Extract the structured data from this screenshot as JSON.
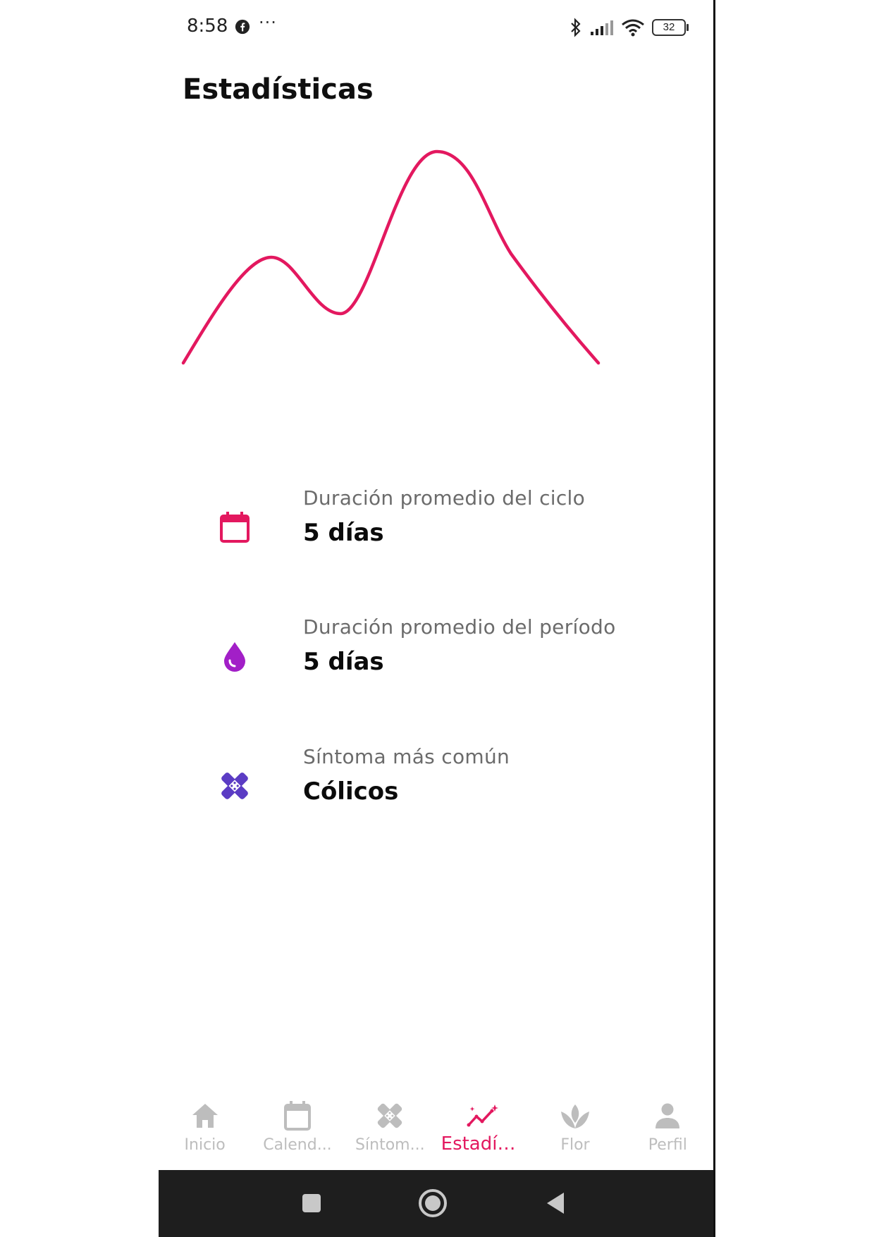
{
  "status_bar": {
    "time": "8:58",
    "more": "···",
    "battery": "32"
  },
  "page": {
    "title": "Estadísticas"
  },
  "colors": {
    "accent": "#e3185f",
    "purple": "#a21fc7",
    "indigo": "#5b3cc4",
    "inactive": "#bdbdbd"
  },
  "stats": [
    {
      "label": "Duración promedio del ciclo",
      "value": "5 días",
      "icon": "calendar-icon"
    },
    {
      "label": "Duración promedio del período",
      "value": "5 días",
      "icon": "drop-icon"
    },
    {
      "label": "Síntoma más común",
      "value": "Cólicos",
      "icon": "bandage-icon"
    }
  ],
  "bottom_nav": [
    {
      "label": "Inicio",
      "icon": "home-icon",
      "active": false
    },
    {
      "label": "Calend...",
      "icon": "calendar-icon",
      "active": false
    },
    {
      "label": "Síntom...",
      "icon": "bandage-icon",
      "active": false
    },
    {
      "label": "Estadíst...",
      "icon": "stats-icon",
      "active": true
    },
    {
      "label": "Flor",
      "icon": "lotus-icon",
      "active": false
    },
    {
      "label": "Perfil",
      "icon": "person-icon",
      "active": false
    }
  ]
}
